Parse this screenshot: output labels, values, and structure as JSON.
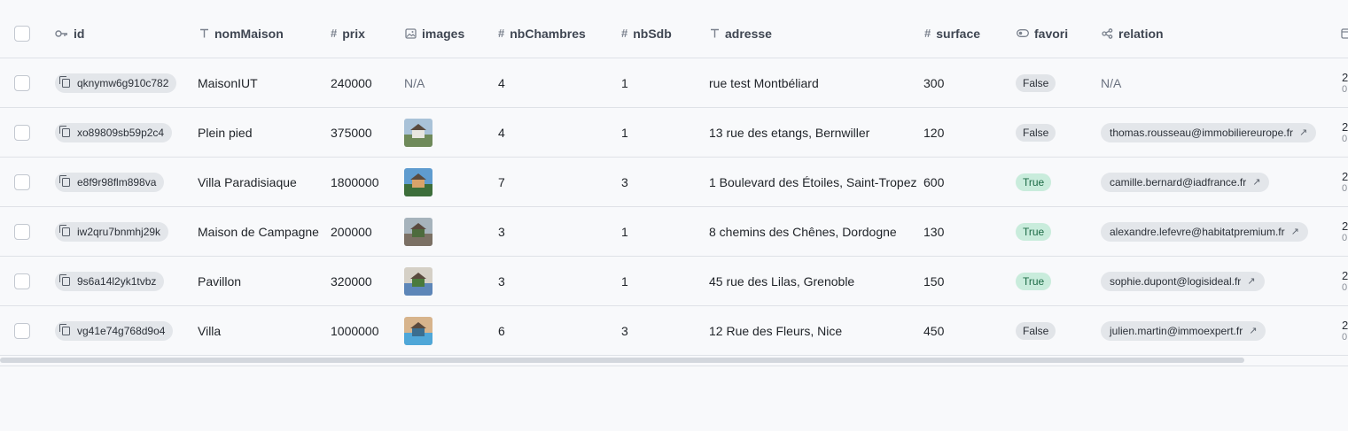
{
  "columns": {
    "id": "id",
    "nomMaison": "nomMaison",
    "prix": "prix",
    "images": "images",
    "nbChambres": "nbChambres",
    "nbSdb": "nbSdb",
    "adresse": "adresse",
    "surface": "surface",
    "favori": "favori",
    "relation": "relation"
  },
  "icons": {
    "id": "key-icon",
    "text": "text-type-icon",
    "number": "hash-icon",
    "image": "image-icon",
    "bool": "toggle-icon",
    "relation": "relation-icon"
  },
  "rows": [
    {
      "id": "qknymw6g910c782",
      "nomMaison": "MaisonIUT",
      "prix": "240000",
      "images": "N/A",
      "nbChambres": "4",
      "nbSdb": "1",
      "adresse": "rue test Montbéliard",
      "surface": "300",
      "favori": "False",
      "relation": "N/A",
      "more_top": "2",
      "more_bottom": "0"
    },
    {
      "id": "xo89809sb59p2c4",
      "nomMaison": "Plein pied",
      "prix": "375000",
      "images": "",
      "nbChambres": "4",
      "nbSdb": "1",
      "adresse": "13 rue des etangs, Bernwiller",
      "surface": "120",
      "favori": "False",
      "relation": "thomas.rousseau@immobiliereurope.fr",
      "more_top": "2",
      "more_bottom": "0"
    },
    {
      "id": "e8f9r98flm898va",
      "nomMaison": "Villa Paradisiaque",
      "prix": "1800000",
      "images": "",
      "nbChambres": "7",
      "nbSdb": "3",
      "adresse": "1 Boulevard des Étoiles, Saint-Tropez",
      "surface": "600",
      "favori": "True",
      "relation": "camille.bernard@iadfrance.fr",
      "more_top": "2",
      "more_bottom": "0"
    },
    {
      "id": "iw2qru7bnmhj29k",
      "nomMaison": "Maison de Campagne",
      "prix": "200000",
      "images": "",
      "nbChambres": "3",
      "nbSdb": "1",
      "adresse": "8 chemins des Chênes, Dordogne",
      "surface": "130",
      "favori": "True",
      "relation": "alexandre.lefevre@habitatpremium.fr",
      "more_top": "2",
      "more_bottom": "0"
    },
    {
      "id": "9s6a14l2yk1tvbz",
      "nomMaison": "Pavillon",
      "prix": "320000",
      "images": "",
      "nbChambres": "3",
      "nbSdb": "1",
      "adresse": "45 rue des Lilas, Grenoble",
      "surface": "150",
      "favori": "True",
      "relation": "sophie.dupont@logisideal.fr",
      "more_top": "2",
      "more_bottom": "0"
    },
    {
      "id": "vg41e74g768d9o4",
      "nomMaison": "Villa",
      "prix": "1000000",
      "images": "",
      "nbChambres": "6",
      "nbSdb": "3",
      "adresse": "12 Rue des Fleurs, Nice",
      "surface": "450",
      "favori": "False",
      "relation": "julien.martin@immoexpert.fr",
      "more_top": "2",
      "more_bottom": "0"
    }
  ],
  "thumb_colors": [
    null,
    [
      "#6f8a5a",
      "#a9c2d8",
      "#e8e6e0"
    ],
    [
      "#3d6e3a",
      "#5f9ccf",
      "#d9a36a"
    ],
    [
      "#7b7064",
      "#a6b3bc",
      "#4d6b3d"
    ],
    [
      "#5d86b8",
      "#d5d0c6",
      "#4a7a3c"
    ],
    [
      "#4fa7d8",
      "#d7b48c",
      "#3b6e8f"
    ]
  ]
}
